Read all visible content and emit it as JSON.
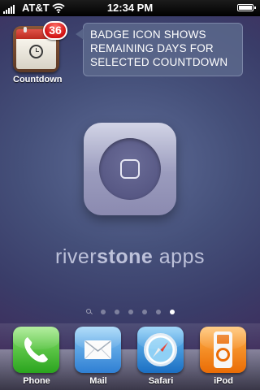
{
  "status_bar": {
    "carrier": "AT&T",
    "time": "12:34 PM",
    "signal_bars": 5,
    "battery_level": 1.0,
    "icons": {
      "signal": "signal-bars-icon",
      "wifi": "wifi-icon",
      "battery": "battery-icon"
    }
  },
  "home": {
    "countdown_app": {
      "label": "Countdown",
      "badge": "36",
      "icon": "calendar-clock-icon"
    },
    "callout": {
      "lines": [
        "BADGE ICON SHOWS",
        "REMAINING DAYS FOR",
        "SELECTED COUNTDOWN"
      ]
    },
    "brand": {
      "name_part1": "river",
      "name_part2": "stone",
      "name_part3": " apps",
      "logo_icon": "riverstone-logo-icon"
    },
    "page_indicator": {
      "pages": 6,
      "active_index": 5,
      "has_search_page": true
    }
  },
  "dock": {
    "apps": [
      {
        "label": "Phone",
        "icon": "phone-icon"
      },
      {
        "label": "Mail",
        "icon": "mail-icon"
      },
      {
        "label": "Safari",
        "icon": "safari-compass-icon"
      },
      {
        "label": "iPod",
        "icon": "ipod-icon"
      }
    ]
  },
  "colors": {
    "badge_red": "#d11414",
    "wallpaper_top": "#5e6c97",
    "wallpaper_bottom": "#2c1d40",
    "callout_bg": "#5c688c"
  }
}
